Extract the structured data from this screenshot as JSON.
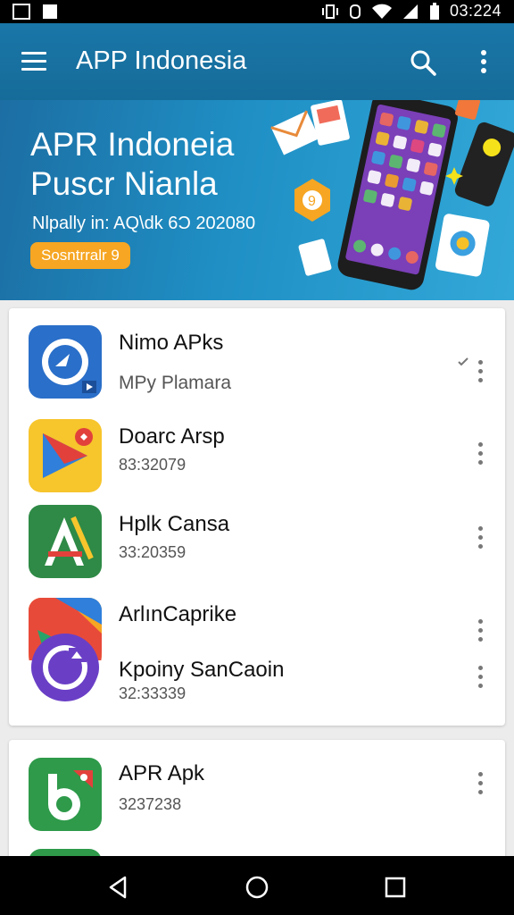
{
  "status_bar": {
    "time": "03:224"
  },
  "app_bar": {
    "title": "APP Indonesia"
  },
  "hero": {
    "title_line1": "APR Indoneia",
    "title_line2": "Puscr Nianla",
    "subtitle": "Nlpally in: AQ\\dk 6Ɔ 202080",
    "cta_label": "Sosntrralr 9"
  },
  "apps": [
    {
      "name": "Nimo APks",
      "meta": "MPy Plamara"
    },
    {
      "name": "Doarc Arsp",
      "meta": "83:32079"
    },
    {
      "name": "Hplk Cansa",
      "meta": "33:20359"
    },
    {
      "name": "ArlınCaprike",
      "meta": ""
    },
    {
      "name": "Kpoiny SanCaoin",
      "meta": "32:33339"
    },
    {
      "name": "APR Apk",
      "meta": "3237238"
    }
  ],
  "colors": {
    "app_bar": "#1976a8",
    "accent": "#f6a623",
    "nav": "#000000"
  }
}
